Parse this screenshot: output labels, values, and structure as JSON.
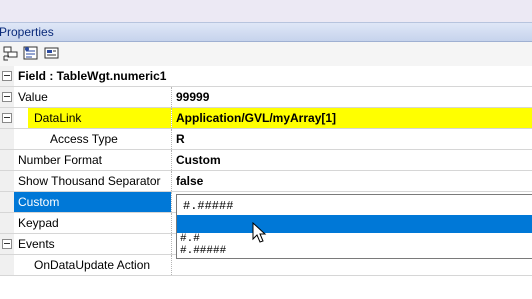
{
  "panel": {
    "title": "Properties"
  },
  "toolbar": {
    "buttons": [
      "categorized-icon",
      "sort-alpha-icon",
      "property-pages-icon"
    ]
  },
  "grid": {
    "header": "Field : TableWgt.numeric1",
    "rows": [
      {
        "name": "Value",
        "value": "99999"
      },
      {
        "name": "DataLink",
        "value": "Application/GVL/myArray[1]"
      },
      {
        "name": "Access Type",
        "value": "R"
      },
      {
        "name": "Number Format",
        "value": "Custom"
      },
      {
        "name": "Show Thousand Separator",
        "value": "false"
      },
      {
        "name": "Custom",
        "value": ""
      },
      {
        "name": "Keypad",
        "value": ""
      },
      {
        "name": "Events",
        "value": ""
      },
      {
        "name": "OnDataUpdate Action",
        "value": ""
      }
    ]
  },
  "dropdown": {
    "current": "#.#####",
    "options": [
      "",
      "#.#",
      "#.#####"
    ]
  },
  "colors": {
    "highlight": "#ffff00",
    "selection": "#0078d7",
    "title_text": "#0a2a7a"
  }
}
